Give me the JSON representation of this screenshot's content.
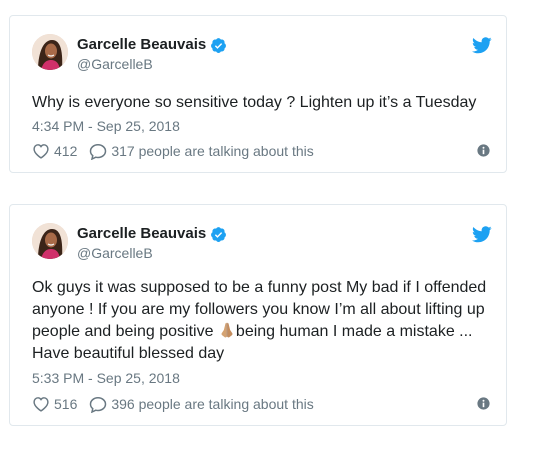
{
  "colors": {
    "twitter_blue": "#1da1f2",
    "text": "#1c2022",
    "muted": "#697882",
    "border": "#e1e8ed"
  },
  "tweets": [
    {
      "author": {
        "name": "Garcelle Beauvais",
        "handle": "@GarcelleB",
        "verified": true,
        "avatar_icon": "avatar-photo"
      },
      "text": "Why is everyone so sensitive today ? Lighten up it’s a Tuesday",
      "timestamp": "4:34 PM - Sep 25, 2018",
      "likes": "412",
      "replies_text": "317 people are talking about this",
      "icons": [
        "twitter-bird-icon",
        "verified-badge-icon",
        "heart-icon",
        "reply-bubble-icon",
        "info-icon"
      ]
    },
    {
      "author": {
        "name": "Garcelle Beauvais",
        "handle": "@GarcelleB",
        "verified": true,
        "avatar_icon": "avatar-photo"
      },
      "text_parts": {
        "before_emoji": "Ok guys it was supposed to be a funny post My bad if I offended anyone ! If you are my followers you know I’m all about lifting up people and being positive ",
        "emoji_icon": "praying-hands-emoji",
        "after_emoji": "being human I made a mistake ... Have beautiful blessed day"
      },
      "timestamp": "5:33 PM - Sep 25, 2018",
      "likes": "516",
      "replies_text": "396 people are talking about this",
      "icons": [
        "twitter-bird-icon",
        "verified-badge-icon",
        "heart-icon",
        "reply-bubble-icon",
        "info-icon"
      ]
    }
  ]
}
